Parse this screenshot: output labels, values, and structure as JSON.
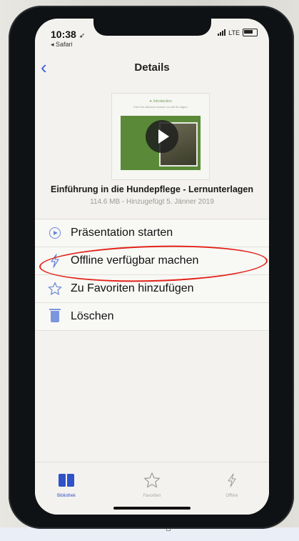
{
  "status": {
    "time": "10:38",
    "back_app": "◂ Safari",
    "network": "LTE"
  },
  "nav": {
    "title": "Details"
  },
  "thumbnail": {
    "heading": "➤ Introduction",
    "subheading": "Eine Ein-Abbruch kennen zu will Ihr dagen"
  },
  "document": {
    "title": "Einführung in die Hundepflege - Lernunterlagen",
    "meta": "114.6 MB - Hinzugefügt 5. Jänner 2019"
  },
  "menu": [
    {
      "label": "Präsentation starten",
      "icon": "play-circle-icon"
    },
    {
      "label": "Offline verfügbar machen",
      "icon": "lightning-icon"
    },
    {
      "label": "Zu Favoriten hinzufügen",
      "icon": "star-icon"
    },
    {
      "label": "Löschen",
      "icon": "trash-icon"
    }
  ],
  "tabs": [
    {
      "label": "Bibliothek",
      "icon": "book-icon",
      "active": true
    },
    {
      "label": "Favoriten",
      "icon": "star-icon",
      "active": false
    },
    {
      "label": "Offline",
      "icon": "lightning-icon",
      "active": false
    }
  ],
  "colors": {
    "accent": "#2f52c8",
    "annotation": "#e2231a"
  }
}
